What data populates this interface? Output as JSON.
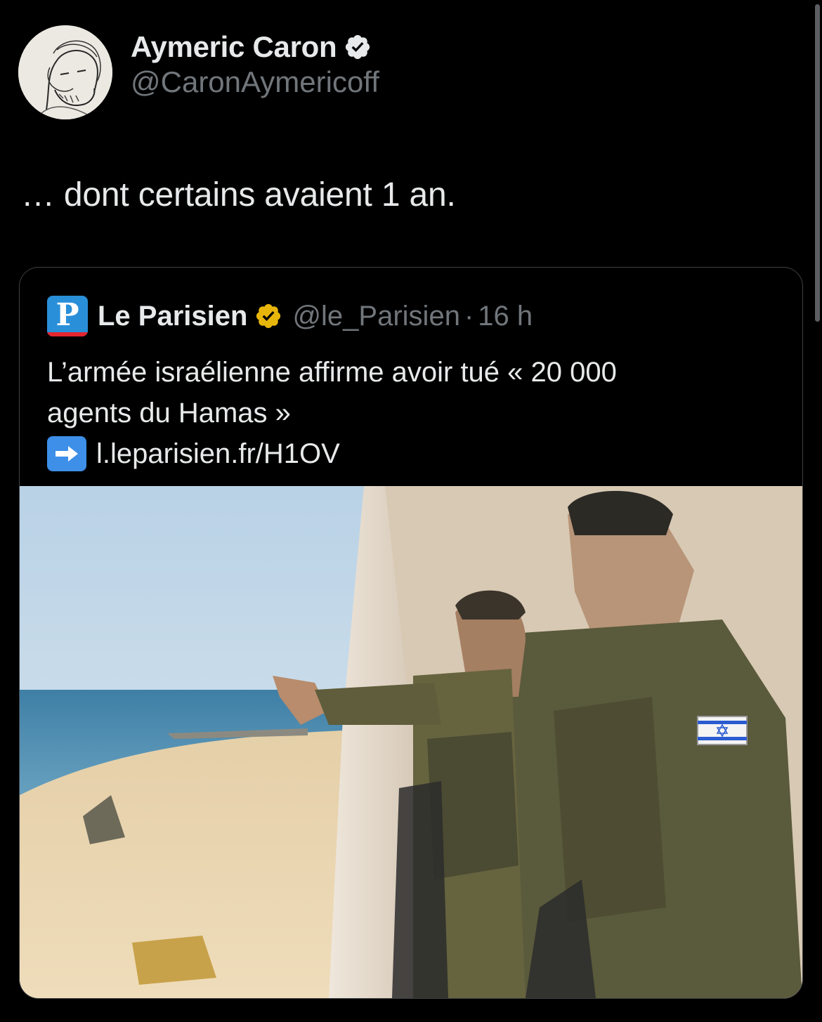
{
  "tweet": {
    "author": {
      "display_name": "Aymeric Caron",
      "handle": "@CaronAymericoff",
      "verified": true,
      "badge_color": "#1d9bf0"
    },
    "text": "… dont certains avaient 1 an."
  },
  "quote": {
    "author": {
      "display_name": "Le Parisien",
      "handle": "@le_Parisien",
      "verified": true,
      "badge_color": "#e8b50b",
      "logo_letter": "P"
    },
    "separator": "·",
    "time": "16 h",
    "text_line1": "L’armée israélienne affirme avoir tué « 20 000",
    "text_line2": "agents du Hamas »",
    "link": "l.leparisien.fr/H1OV",
    "link_icon": "right-arrow-emoji-icon"
  },
  "colors": {
    "background": "#000000",
    "text_primary": "#e7e9ea",
    "text_secondary": "#71767b",
    "border": "#3e4144"
  }
}
